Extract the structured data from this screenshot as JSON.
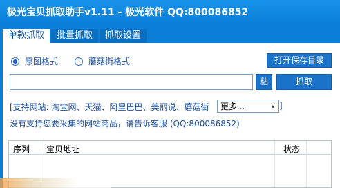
{
  "window": {
    "title": "极光宝贝抓取助手v1.11 - 极光软件 QQ:800086852"
  },
  "tabs": [
    {
      "label": "单款抓取",
      "active": true
    },
    {
      "label": "批量抓取",
      "active": false
    },
    {
      "label": "抓取设置",
      "active": false
    }
  ],
  "options": {
    "original_format": {
      "label": "原图格式",
      "selected": true
    },
    "mogujie_format": {
      "label": "蘑菇街格式",
      "selected": false
    }
  },
  "buttons": {
    "open_save_dir": "打开保存目录",
    "paste": "粘",
    "grab": "抓取"
  },
  "url_input": {
    "value": "",
    "placeholder": ""
  },
  "supported_sites": "[支持网站: 淘宝网、天猫、阿里巴巴、美丽说、蘑菇街",
  "more_select": {
    "value": "更多..."
  },
  "bracket_close": "]",
  "notice": "没有支持您要采集的网站商品，请告诉客服 (QQ:800086852)",
  "table": {
    "columns": [
      "序列",
      "宝贝地址",
      "状态"
    ],
    "rows": []
  },
  "colors": {
    "window_blue": "#0b7fd7",
    "button_blue": "#1b72c9",
    "text_blue": "#1d4fa0"
  }
}
